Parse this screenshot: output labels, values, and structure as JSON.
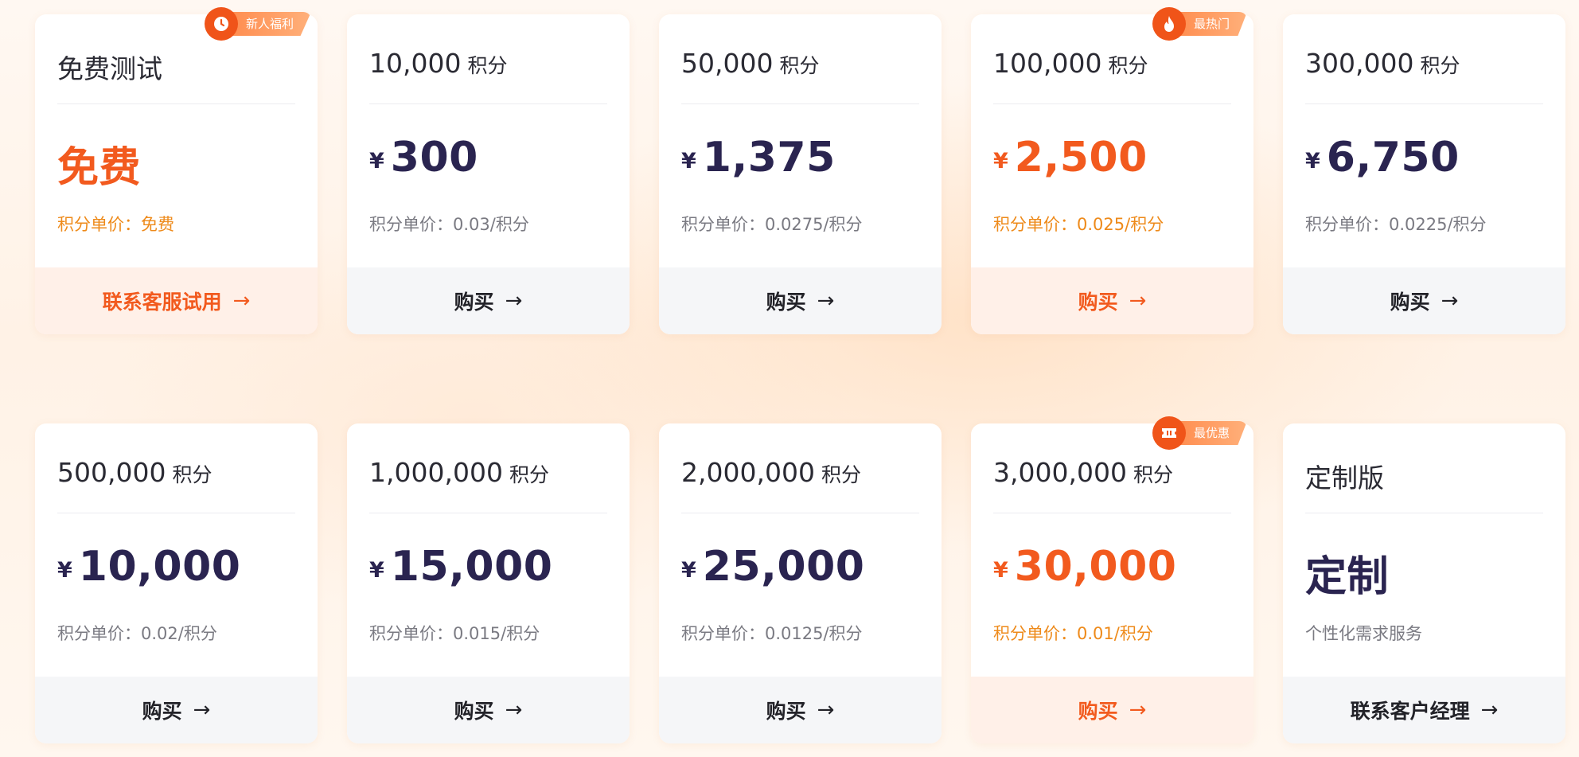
{
  "colors": {
    "accent": "#f25a1e",
    "accent_soft": "#ee8a1a",
    "price_dark": "#2a2450",
    "footer_gray": "#f5f6f8",
    "footer_hot": "#fff0e8"
  },
  "cards": [
    {
      "name": "免费测试",
      "unit": "",
      "currency": "",
      "amount": "免费",
      "unit_price": "积分单价：免费",
      "action": "联系客服试用",
      "badge": "新人福利",
      "badge_icon": "clock-icon"
    },
    {
      "name": "10,000",
      "unit": "积分",
      "currency": "¥",
      "amount": "300",
      "unit_price": "积分单价：0.03/积分",
      "action": "购买"
    },
    {
      "name": "50,000",
      "unit": "积分",
      "currency": "¥",
      "amount": "1,375",
      "unit_price": "积分单价：0.0275/积分",
      "action": "购买"
    },
    {
      "name": "100,000",
      "unit": "积分",
      "currency": "¥",
      "amount": "2,500",
      "unit_price": "积分单价：0.025/积分",
      "action": "购买",
      "badge": "最热门",
      "badge_icon": "flame-icon"
    },
    {
      "name": "300,000",
      "unit": "积分",
      "currency": "¥",
      "amount": "6,750",
      "unit_price": "积分单价：0.0225/积分",
      "action": "购买"
    },
    {
      "name": "500,000",
      "unit": "积分",
      "currency": "¥",
      "amount": "10,000",
      "unit_price": "积分单价：0.02/积分",
      "action": "购买"
    },
    {
      "name": "1,000,000",
      "unit": "积分",
      "currency": "¥",
      "amount": "15,000",
      "unit_price": "积分单价：0.015/积分",
      "action": "购买"
    },
    {
      "name": "2,000,000",
      "unit": "积分",
      "currency": "¥",
      "amount": "25,000",
      "unit_price": "积分单价：0.0125/积分",
      "action": "购买"
    },
    {
      "name": "3,000,000",
      "unit": "积分",
      "currency": "¥",
      "amount": "30,000",
      "unit_price": "积分单价：0.01/积分",
      "action": "购买",
      "badge": "最优惠",
      "badge_icon": "ticket-icon"
    },
    {
      "name": "定制版",
      "unit": "",
      "currency": "",
      "amount": "定制",
      "unit_price": "个性化需求服务",
      "action": "联系客户经理"
    }
  ]
}
